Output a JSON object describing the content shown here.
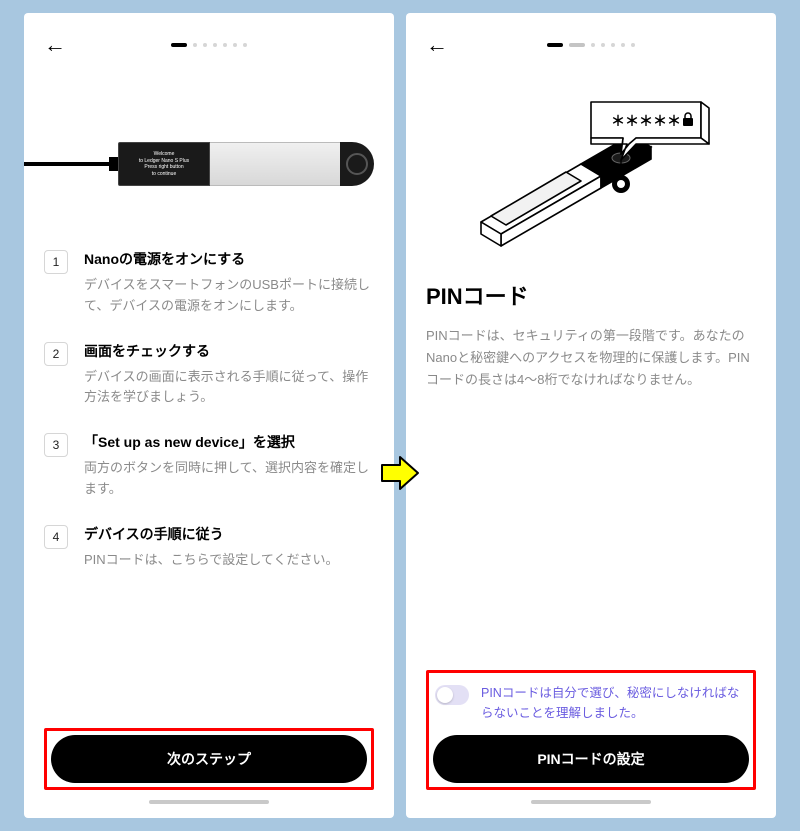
{
  "left": {
    "device_text_l1": "Welcome",
    "device_text_l2": "to Ledger Nano S Plus",
    "device_text_l3": "Press right button",
    "device_text_l4": "to continue",
    "steps": [
      {
        "num": "1",
        "title": "Nanoの電源をオンにする",
        "desc": "デバイスをスマートフォンのUSBポートに接続して、デバイスの電源をオンにします。"
      },
      {
        "num": "2",
        "title": "画面をチェックする",
        "desc": "デバイスの画面に表示される手順に従って、操作方法を学びましょう。"
      },
      {
        "num": "3",
        "title": "「Set up as new device」を選択",
        "desc": "両方のボタンを同時に押して、選択内容を確定します。"
      },
      {
        "num": "4",
        "title": "デバイスの手順に従う",
        "desc": "PINコードは、こちらで設定してください。"
      }
    ],
    "cta": "次のステップ"
  },
  "right": {
    "title": "PINコード",
    "desc": "PINコードは、セキュリティの第一段階です。あなたのNanoと秘密鍵へのアクセスを物理的に保護します。PINコードの長さは4～8桁でなければなりません。",
    "consent": "PINコードは自分で選び、秘密にしなければならないことを理解しました。",
    "cta": "PINコードの設定",
    "bubble_text": "＊＊＊＊＊"
  }
}
